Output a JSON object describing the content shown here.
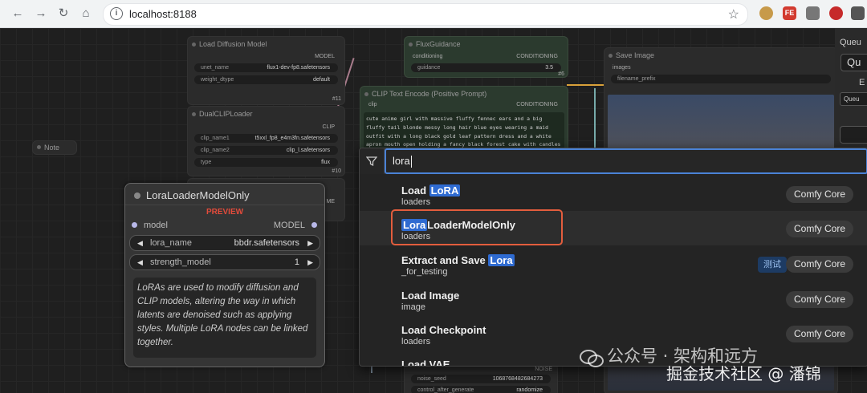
{
  "browser": {
    "url": "localhost:8188"
  },
  "bg_nodes": {
    "load_diffusion": {
      "title": "Load Diffusion Model",
      "output": "MODEL",
      "unet_label": "unet_name",
      "unet_value": "flux1-dev-fp8.safetensors",
      "dtype_label": "weight_dtype",
      "dtype_value": "default",
      "id": "#11"
    },
    "dual_clip": {
      "title": "DualCLIPLoader",
      "output": "CLIP",
      "clip1_label": "clip_name1",
      "clip1_value": "t5xxl_fp8_e4m3fn.safetensors",
      "clip2_label": "clip_name2",
      "clip2_value": "clip_l.safetensors",
      "type_label": "type",
      "type_value": "flux",
      "id": "#10"
    },
    "flux_guidance": {
      "title": "FluxGuidance",
      "input": "conditioning",
      "output": "CONDITIONING",
      "guidance_label": "guidance",
      "guidance_value": "3.5",
      "id": "#6"
    },
    "clip_text": {
      "title": "CLIP Text Encode (Positive Prompt)",
      "input": "clip",
      "output": "CONDITIONING",
      "prompt": "cute anime girl with massive fluffy fennec ears and a big fluffy tail blonde messy long hair blue eyes wearing a maid outfit with a long black gold leaf pattern dress and a white apron mouth open holding a fancy black forest cake with candles on top in the kitchen of an old dark Victorian mansion lit by candlelight with a"
    },
    "save_image": {
      "title": "Save Image",
      "input": "images",
      "prefix_label": "filename_prefix"
    },
    "note": {
      "title": "Note"
    },
    "sampler": {
      "noise_label": "noise_seed",
      "noise_value": "1068768482684273",
      "noise_out": "NOISE",
      "control_label": "control_after_generate",
      "control_value": "randomize"
    },
    "queue_partial": {
      "a": "Queu",
      "b": "Qu",
      "c": "E",
      "d": "Queu"
    },
    "partial_output": "ME"
  },
  "lora_node": {
    "title": "LoraLoaderModelOnly",
    "preview": "PREVIEW",
    "input": "model",
    "output": "MODEL",
    "lora_name_label": "lora_name",
    "lora_name_value": "bbdr.safetensors",
    "strength_label": "strength_model",
    "strength_value": "1",
    "description": "LoRAs are used to modify diffusion and CLIP models, altering the way in which latents are denoised such as applying styles. Multiple LoRA nodes can be linked together."
  },
  "search": {
    "query": "lora",
    "results": [
      {
        "pre": "Load ",
        "hl": "LoRA",
        "post": "",
        "category": "loaders",
        "badge": "Comfy Core",
        "extra": ""
      },
      {
        "pre": "",
        "hl": "Lora",
        "post": "LoaderModelOnly",
        "category": "loaders",
        "badge": "Comfy Core",
        "extra": ""
      },
      {
        "pre": "Extract and Save ",
        "hl": "Lora",
        "post": "",
        "category": "_for_testing",
        "badge": "Comfy Core",
        "extra": "测试"
      },
      {
        "pre": "Load Image",
        "hl": "",
        "post": "",
        "category": "image",
        "badge": "Comfy Core",
        "extra": ""
      },
      {
        "pre": "Load Checkpoint",
        "hl": "",
        "post": "",
        "category": "loaders",
        "badge": "Comfy Core",
        "extra": ""
      },
      {
        "pre": "Load VAE",
        "hl": "",
        "post": "",
        "category": "",
        "badge": "",
        "extra": ""
      }
    ]
  },
  "watermark": {
    "line1": "公众号 · 架构和远方",
    "line2": "掘金技术社区 @ 潘锦"
  },
  "colors": {
    "highlight": "#2f6bd1",
    "selection": "#e35d3d",
    "preview": "#e34b3b"
  }
}
